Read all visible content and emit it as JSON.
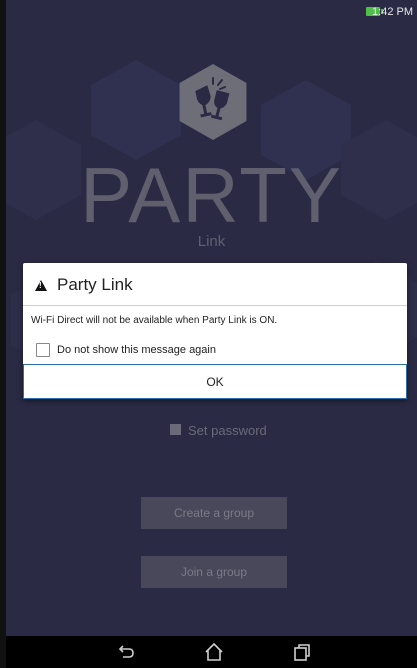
{
  "status_bar": {
    "time": "1:42 PM"
  },
  "brand": {
    "title": "PARTY",
    "subtitle": "Link"
  },
  "dialog": {
    "title": "Party Link",
    "message": "Wi-Fi Direct will not be available when Party Link is ON.",
    "checkbox_label": "Do not show this message again",
    "ok_label": "OK"
  },
  "options": {
    "set_password_label": "Set password"
  },
  "buttons": {
    "create_group": "Create a group",
    "join_group": "Join a group"
  },
  "colors": {
    "background": "#2a2a45",
    "logo": "#6e6e78",
    "dialog_button_border": "#2d6da8",
    "group_button": "#48485a",
    "battery": "#4fbf4a"
  },
  "icons": {
    "status": "battery-charging-icon",
    "dialog": "warning-icon",
    "logo": "toasting-glasses-icon",
    "nav": [
      "back-icon",
      "home-icon",
      "recents-icon"
    ]
  }
}
